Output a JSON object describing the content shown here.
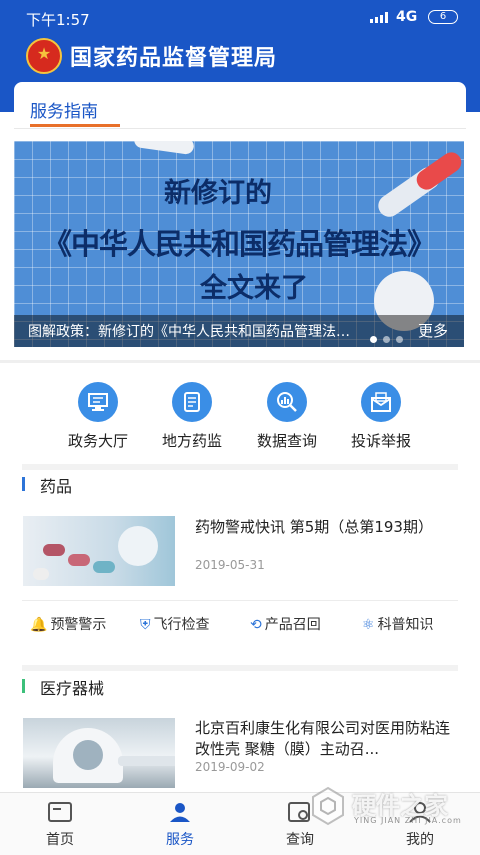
{
  "status": {
    "time": "下午1:57",
    "network": "4G",
    "battery": "6"
  },
  "header": {
    "title": "国家药品监督管理局"
  },
  "tab": {
    "label": "服务指南"
  },
  "banner": {
    "line1": "新修订的",
    "line2": "《中华人民共和国药品管理法》",
    "line3": "全文来了",
    "caption": "图解政策：新修订的《中华人民共和国药品管理法》（四）",
    "more": "更多"
  },
  "quick_entries": [
    {
      "label": "政务大厅",
      "icon": "computer-icon"
    },
    {
      "label": "地方药监",
      "icon": "document-list-icon"
    },
    {
      "label": "数据查询",
      "icon": "search-chart-icon"
    },
    {
      "label": "投诉举报",
      "icon": "envelope-icon"
    }
  ],
  "section_drugs": {
    "title": "药品",
    "news": {
      "title": "药物警戒快讯 第5期（总第193期）",
      "date": "2019-05-31"
    },
    "tags": [
      {
        "label": "预警警示",
        "icon": "bell-icon"
      },
      {
        "label": "飞行检查",
        "icon": "shield-icon"
      },
      {
        "label": "产品召回",
        "icon": "recall-icon"
      },
      {
        "label": "科普知识",
        "icon": "atom-icon"
      }
    ]
  },
  "section_devices": {
    "title": "医疗器械",
    "news": {
      "title": "北京百利康生化有限公司对医用防粘连改性壳 聚糖（膜）主动召...",
      "date": "2019-09-02"
    }
  },
  "nav": {
    "items": [
      {
        "label": "首页",
        "icon": "home-icon"
      },
      {
        "label": "服务",
        "icon": "service-icon"
      },
      {
        "label": "查询",
        "icon": "query-icon"
      },
      {
        "label": "我的",
        "icon": "user-icon"
      }
    ],
    "active": "服务"
  },
  "watermark": {
    "cn": "硬件之家",
    "en": "YING JIAN ZHI JIA.com"
  },
  "colors": {
    "primary": "#1a56c6",
    "accent": "#e8702a",
    "icon_blue": "#3a8ee6"
  }
}
